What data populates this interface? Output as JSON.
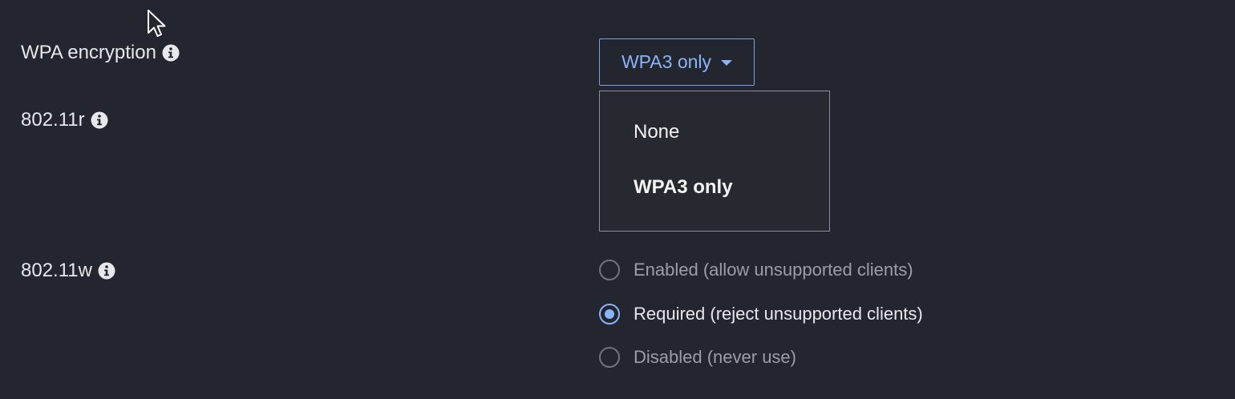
{
  "settings": {
    "wpa": {
      "label": "WPA encryption",
      "selected_value": "WPA3 only",
      "options": [
        "None",
        "WPA3 only"
      ]
    },
    "r80211": {
      "label": "802.11r"
    },
    "w80211": {
      "label": "802.11w",
      "options": [
        {
          "label": "Enabled (allow unsupported clients)",
          "checked": false
        },
        {
          "label": "Required (reject unsupported clients)",
          "checked": true
        },
        {
          "label": "Disabled (never use)",
          "checked": false
        }
      ]
    }
  },
  "colors": {
    "background": "#23262e",
    "accent": "#8ab4f8",
    "text": "#e6e8ec",
    "muted_text": "#9a9ea6"
  },
  "icons": {
    "info": "info-icon",
    "caret": "caret-down-icon",
    "cursor": "mouse-pointer-icon"
  }
}
